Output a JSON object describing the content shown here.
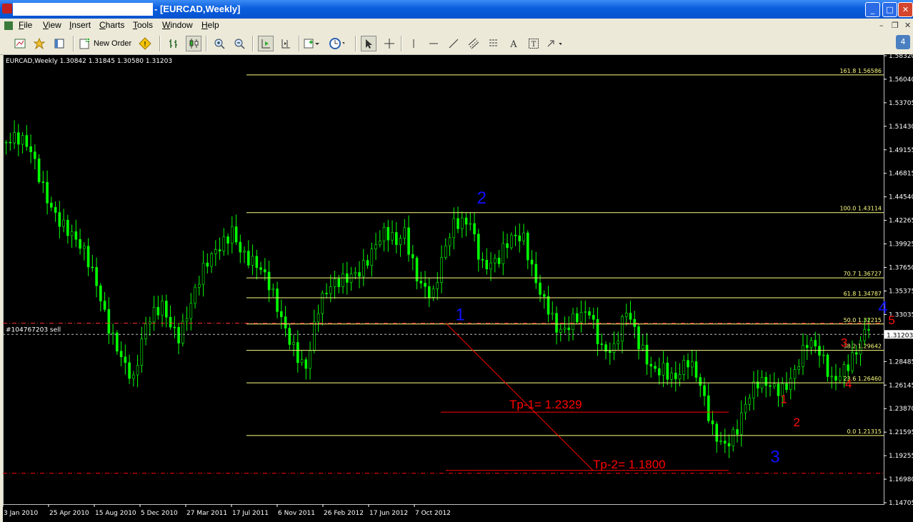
{
  "window": {
    "account_masked": "",
    "title_suffix": "- [EURCAD,Weekly]",
    "buttons": [
      "_",
      "□",
      "✕"
    ]
  },
  "menu": [
    "File",
    "View",
    "Insert",
    "Charts",
    "Tools",
    "Window",
    "Help"
  ],
  "toolbar": {
    "new_order_label": "New Order",
    "tools": [
      "new-chart",
      "profiles",
      "market-watch",
      "new-order",
      "autotrading",
      "bar-chart",
      "candlesticks",
      "zoom-in",
      "zoom-out",
      "auto-scroll",
      "chart-shift",
      "indicators",
      "periods",
      "cursor",
      "crosshair",
      "vertical-line",
      "horizontal-line",
      "trendline",
      "equidistant-channel",
      "fibonacci",
      "text",
      "text-label",
      "arrows"
    ]
  },
  "side_badge": "4",
  "chart_data": {
    "type": "candlestick",
    "header": "EURCAD,Weekly  1.30842 1.31845 1.30580 1.31203",
    "ylim": [
      1.146,
      1.586
    ],
    "y_ticks": [
      "1.58320",
      "1.56040",
      "1.53705",
      "1.51430",
      "1.49155",
      "1.46815",
      "1.44540",
      "1.42265",
      "1.39925",
      "1.37650",
      "1.35375",
      "1.33035",
      "1.31203",
      "1.28485",
      "1.26145",
      "1.23870",
      "1.21595",
      "1.19255",
      "1.16980",
      "1.14705"
    ],
    "current_price": "1.31203",
    "x_ticks": [
      "3 Jan 2010",
      "25 Apr 2010",
      "15 Aug 2010",
      "5 Dec 2010",
      "27 Mar 2011",
      "17 Jul 2011",
      "6 Nov 2011",
      "26 Feb 2012",
      "17 Jun 2012",
      "7 Oct 2012"
    ],
    "price_path": [
      [
        0,
        1.5
      ],
      [
        6,
        1.485
      ],
      [
        12,
        1.44
      ],
      [
        17,
        1.395
      ],
      [
        22,
        1.36
      ],
      [
        27,
        1.31
      ],
      [
        31,
        1.26
      ],
      [
        34,
        1.31
      ],
      [
        38,
        1.345
      ],
      [
        42,
        1.32
      ],
      [
        45,
        1.34
      ],
      [
        50,
        1.38
      ],
      [
        55,
        1.425
      ],
      [
        58,
        1.395
      ],
      [
        62,
        1.365
      ],
      [
        66,
        1.335
      ],
      [
        70,
        1.31
      ],
      [
        73,
        1.285
      ],
      [
        76,
        1.33
      ],
      [
        80,
        1.355
      ],
      [
        84,
        1.38
      ],
      [
        88,
        1.39
      ],
      [
        92,
        1.4
      ],
      [
        95,
        1.395
      ],
      [
        97,
        1.415
      ],
      [
        100,
        1.38
      ],
      [
        104,
        1.35
      ],
      [
        106,
        1.375
      ],
      [
        109,
        1.41
      ],
      [
        113,
        1.43
      ],
      [
        116,
        1.39
      ],
      [
        120,
        1.38
      ],
      [
        123,
        1.395
      ],
      [
        126,
        1.405
      ],
      [
        129,
        1.375
      ],
      [
        132,
        1.345
      ],
      [
        134,
        1.315
      ],
      [
        136,
        1.305
      ],
      [
        139,
        1.32
      ],
      [
        142,
        1.34
      ],
      [
        145,
        1.31
      ],
      [
        148,
        1.3
      ],
      [
        151,
        1.325
      ],
      [
        154,
        1.295
      ],
      [
        157,
        1.285
      ],
      [
        160,
        1.29
      ],
      [
        163,
        1.27
      ],
      [
        166,
        1.275
      ],
      [
        169,
        1.255
      ],
      [
        172,
        1.225
      ],
      [
        175,
        1.215
      ],
      [
        178,
        1.22
      ],
      [
        180,
        1.235
      ],
      [
        183,
        1.255
      ],
      [
        186,
        1.265
      ],
      [
        189,
        1.27
      ],
      [
        192,
        1.28
      ],
      [
        195,
        1.295
      ],
      [
        198,
        1.285
      ],
      [
        201,
        1.27
      ],
      [
        204,
        1.29
      ],
      [
        207,
        1.3
      ],
      [
        210,
        1.312
      ]
    ],
    "x_total": 245,
    "fib_levels": [
      {
        "label": "161.8  1.56586",
        "price": 1.56586
      },
      {
        "label": "100.0  1.43114",
        "price": 1.43114
      },
      {
        "label": "70.7  1.36727",
        "price": 1.36727
      },
      {
        "label": "61.8  1.34787",
        "price": 1.34787
      },
      {
        "label": "50.0  1.32215",
        "price": 1.32215
      },
      {
        "label": "38.2  1.29642",
        "price": 1.29642
      },
      {
        "label": "23.6  1.26460",
        "price": 1.2646
      },
      {
        "label": "0.0  1.21315",
        "price": 1.21315
      }
    ],
    "order_line": {
      "label": "#104767203 sell",
      "price": 1.323
    },
    "tp_lines": [
      {
        "label": "Tp-1= 1.2329",
        "price": 1.236
      },
      {
        "label": "Tp-2= 1.1800",
        "price": 1.179
      }
    ],
    "wave_labels_blue": [
      {
        "text": "2",
        "x": 111,
        "price": 1.44
      },
      {
        "text": "1",
        "x": 106,
        "price": 1.326
      },
      {
        "text": "3",
        "x": 179,
        "price": 1.187
      },
      {
        "text": "4",
        "x": 204,
        "price": 1.333
      }
    ],
    "wave_labels_red": [
      {
        "text": "1",
        "x": 181,
        "price": 1.245
      },
      {
        "text": "2",
        "x": 184,
        "price": 1.222
      },
      {
        "text": "3",
        "x": 195,
        "price": 1.3
      },
      {
        "text": "4",
        "x": 196,
        "price": 1.26
      },
      {
        "text": "5",
        "x": 206,
        "price": 1.322
      }
    ],
    "colors": {
      "background": "#000000",
      "candles": "#00ff00",
      "fib": "#ffff80",
      "order": "#ff3030",
      "tp": "#ff0000",
      "wave_blue": "#1010ff",
      "wave_red": "#ff1010",
      "axis": "#ffffff"
    }
  }
}
